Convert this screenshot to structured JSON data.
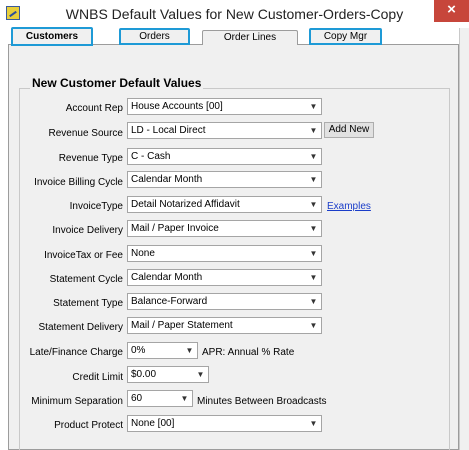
{
  "window": {
    "title": "WNBS Default Values for New Customer-Orders-Copy",
    "close_label": "×"
  },
  "tabs": [
    {
      "label": "Customers"
    },
    {
      "label": "Orders"
    },
    {
      "label": "Order Lines"
    },
    {
      "label": "Copy Mgr"
    }
  ],
  "section_title": "New Customer Default Values",
  "fields": {
    "account_rep": {
      "label": "Account Rep",
      "value": "House Accounts [00]"
    },
    "revenue_source": {
      "label": "Revenue Source",
      "value": "LD - Local Direct",
      "button": "Add New"
    },
    "revenue_type": {
      "label": "Revenue Type",
      "value": "C - Cash"
    },
    "invoice_billing_cycle": {
      "label": "Invoice Billing Cycle",
      "value": "Calendar Month"
    },
    "invoice_type": {
      "label": "InvoiceType",
      "value": "Detail Notarized Affidavit",
      "link": "Examples"
    },
    "invoice_delivery": {
      "label": "Invoice Delivery",
      "value": "Mail / Paper Invoice"
    },
    "invoice_tax": {
      "label": "InvoiceTax or Fee",
      "value": "None"
    },
    "statement_cycle": {
      "label": "Statement  Cycle",
      "value": "Calendar Month"
    },
    "statement_type": {
      "label": "Statement Type",
      "value": "Balance-Forward"
    },
    "statement_delivery": {
      "label": "Statement Delivery",
      "value": "Mail / Paper Statement"
    },
    "late_finance_charge": {
      "label": "Late/Finance Charge",
      "value": "0%",
      "note": "APR: Annual % Rate"
    },
    "credit_limit": {
      "label": "Credit Limit",
      "value": "$0.00"
    },
    "minimum_separation": {
      "label": "Minimum Separation",
      "value": "60",
      "note": "Minutes Between Broadcasts"
    },
    "product_protect": {
      "label": "Product Protect",
      "value": "None [00]"
    }
  },
  "icons": {
    "dropdown_arrow": "chevron-down-icon",
    "app": "app-icon",
    "close": "close-icon"
  },
  "colors": {
    "highlight": "#1e9ad6",
    "close": "#c7463b",
    "link": "#1a3dc9"
  }
}
